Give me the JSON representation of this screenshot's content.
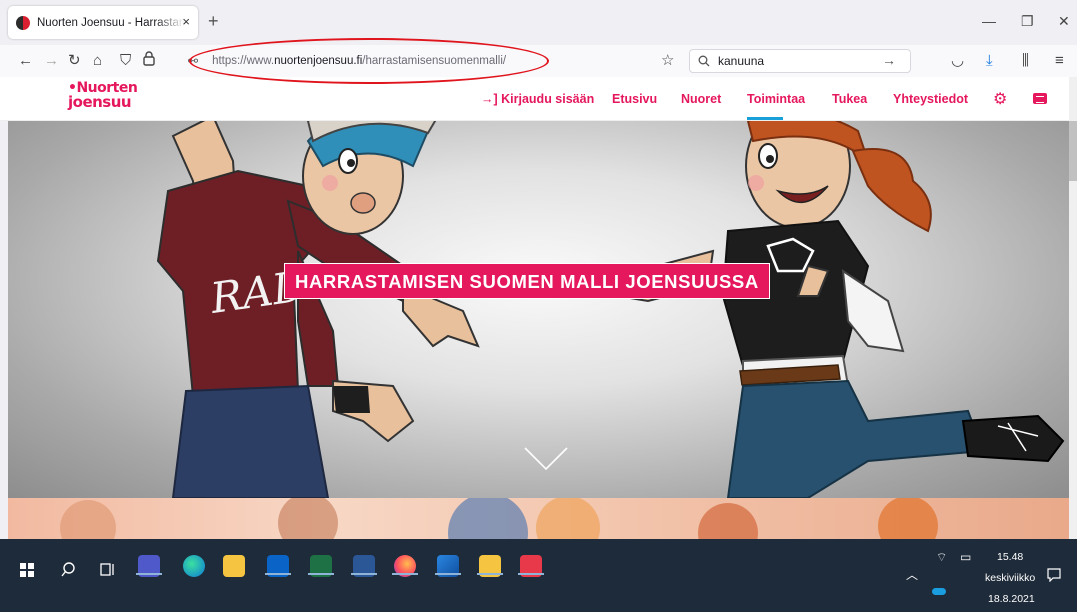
{
  "browser": {
    "tab_title": "Nuorten Joensuu - Harrastamisen Suomen malli Joensuussa",
    "tab_close": "×",
    "new_tab": "+",
    "url_prefix": "https://www.",
    "url_domain": "nuortenjoensuu.fi",
    "url_path": "/harrastamisensuomenmalli/",
    "search_value": "kanuuna"
  },
  "site": {
    "logo_line1": "•Nuorten",
    "logo_line2": "joensuu",
    "menu": {
      "login": "→] Kirjaudu sisään",
      "home": "Etusivu",
      "youth": "Nuoret",
      "activities": "Toimintaa",
      "support": "Tukea",
      "contact": "Yhteystiedot"
    },
    "active_menu": "Toimintaa",
    "hero_title": "HARRASTAMISEN SUOMEN MALLI JOENSUUSSA",
    "shirt_text": "RAD",
    "accent_color": "#e5175d"
  },
  "taskbar": {
    "time": "15.48",
    "weekday": "keskiviikko",
    "date": "18.8.2021",
    "apps": [
      "teams-icon",
      "edge-icon",
      "file-explorer-icon",
      "outlook-icon",
      "excel-icon",
      "word-icon",
      "firefox-icon",
      "photos-icon",
      "file-explorer-icon",
      "pdf-icon"
    ]
  }
}
